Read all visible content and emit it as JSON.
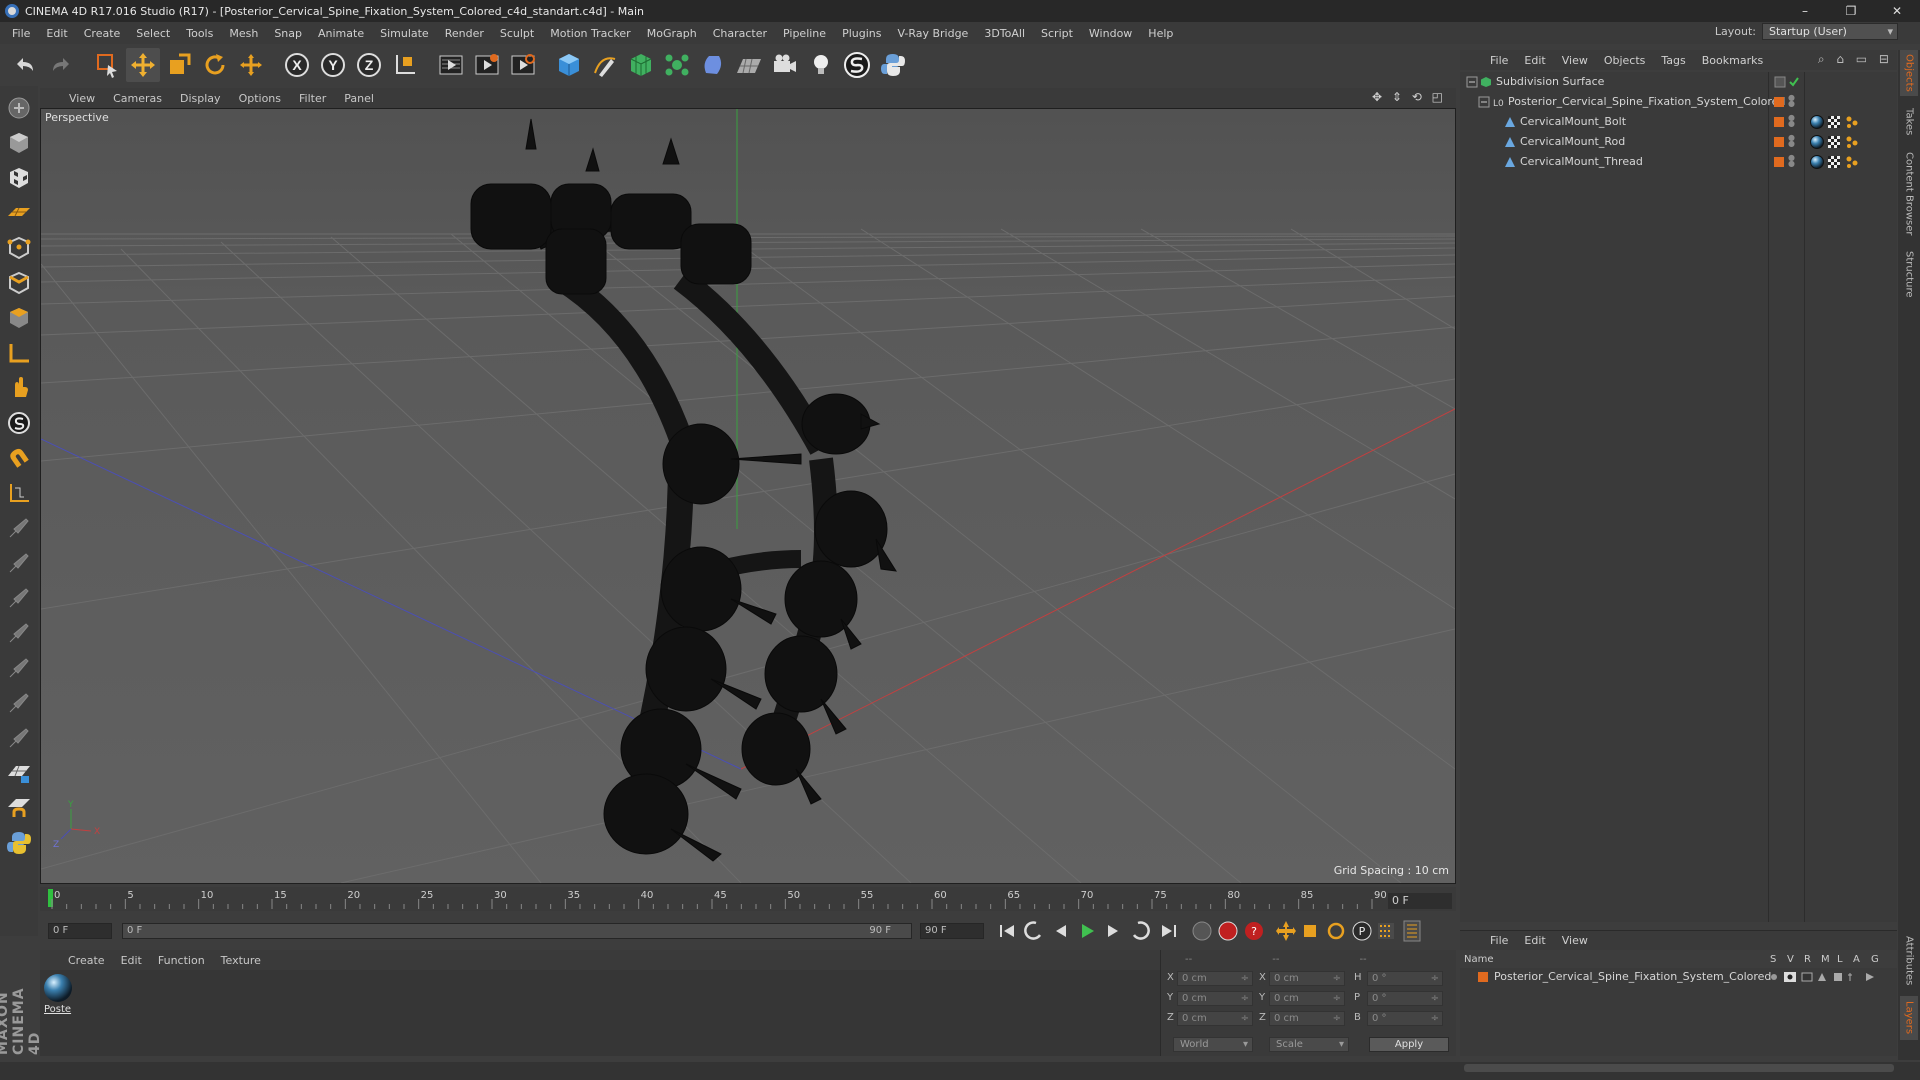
{
  "window": {
    "title": "CINEMA 4D R17.016 Studio (R17) - [Posterior_Cervical_Spine_Fixation_System_Colored_c4d_standart.c4d] - Main",
    "controls": [
      "–",
      "❐",
      "✕"
    ]
  },
  "menubar": {
    "items": [
      "File",
      "Edit",
      "Create",
      "Select",
      "Tools",
      "Mesh",
      "Snap",
      "Animate",
      "Simulate",
      "Render",
      "Sculpt",
      "Motion Tracker",
      "MoGraph",
      "Character",
      "Pipeline",
      "Plugins",
      "V-Ray Bridge",
      "3DToAll",
      "Script",
      "Window",
      "Help"
    ],
    "layout_label": "Layout:",
    "layout_value": "Startup (User)"
  },
  "toolbar": {
    "icons": [
      "undo-icon",
      "redo-icon",
      "live-selection-icon",
      "move-icon",
      "scale-icon",
      "rotate-icon",
      "transform-icon",
      "x-axis-icon",
      "y-axis-icon",
      "z-axis-icon",
      "coordinate-system-icon",
      "render-view-icon",
      "render-picture-viewer-icon",
      "edit-render-settings-icon",
      "cube-icon",
      "pen-spline-icon",
      "subdivision-surface-icon",
      "mograph-cloner-icon",
      "deformer-icon",
      "floor-icon",
      "camera-icon",
      "light-icon",
      "sketch-toon-icon",
      "python-icon"
    ],
    "axis_labels": [
      "X",
      "Y",
      "Z"
    ]
  },
  "viewport": {
    "menu": [
      "View",
      "Cameras",
      "Display",
      "Options",
      "Filter",
      "Panel"
    ],
    "label": "Perspective",
    "grid_spacing": "Grid Spacing : 10 cm",
    "axis_gizmo": [
      "Y",
      "X",
      "Z"
    ]
  },
  "timeline": {
    "ticks": [
      "0",
      "5",
      "10",
      "15",
      "20",
      "25",
      "30",
      "35",
      "40",
      "45",
      "50",
      "55",
      "60",
      "65",
      "70",
      "75",
      "80",
      "85",
      "90"
    ],
    "current_frame": "0 F",
    "start_field": "0 F",
    "range_start": "0 F",
    "range_end": "90 F",
    "end_field": "90 F"
  },
  "materials": {
    "menu": [
      "Create",
      "Edit",
      "Function",
      "Texture"
    ],
    "items": [
      {
        "name": "Poste"
      }
    ]
  },
  "coordinates": {
    "header": [
      "--",
      "--",
      "--"
    ],
    "rows": [
      {
        "a1": "X",
        "v1": "0 cm",
        "a2": "X",
        "v2": "0 cm",
        "a3": "H",
        "v3": "0 °"
      },
      {
        "a1": "Y",
        "v1": "0 cm",
        "a2": "Y",
        "v2": "0 cm",
        "a3": "P",
        "v3": "0 °"
      },
      {
        "a1": "Z",
        "v1": "0 cm",
        "a2": "Z",
        "v2": "0 cm",
        "a3": "B",
        "v3": "0 °"
      }
    ],
    "mode": "World",
    "transform": "Scale",
    "apply": "Apply"
  },
  "objects": {
    "menu": [
      "File",
      "Edit",
      "View",
      "Objects",
      "Tags",
      "Bookmarks"
    ],
    "rows": [
      {
        "name": "Subdivision Surface",
        "level": 0
      },
      {
        "name": "Posterior_Cervical_Spine_Fixation_System_Colored",
        "level": 1
      },
      {
        "name": "CervicalMount_Bolt",
        "level": 2
      },
      {
        "name": "CervicalMount_Rod",
        "level": 2
      },
      {
        "name": "CervicalMount_Thread",
        "level": 2
      }
    ]
  },
  "right_tabs": [
    "Objects",
    "Takes",
    "Content Browser",
    "Structure",
    "Attributes",
    "Layers"
  ],
  "layers": {
    "menu": [
      "File",
      "Edit",
      "View"
    ],
    "header_name": "Name",
    "header_cols": [
      "S",
      "V",
      "R",
      "M",
      "L",
      "A",
      "G"
    ],
    "row_name": "Posterior_Cervical_Spine_Fixation_System_Colored"
  },
  "branding": {
    "logo_text": "MAXON CINEMA 4D"
  },
  "colors": {
    "accent": "#e06a1f",
    "object_tag": "#e06a1f",
    "toolbar_blue": "#3770b8"
  }
}
